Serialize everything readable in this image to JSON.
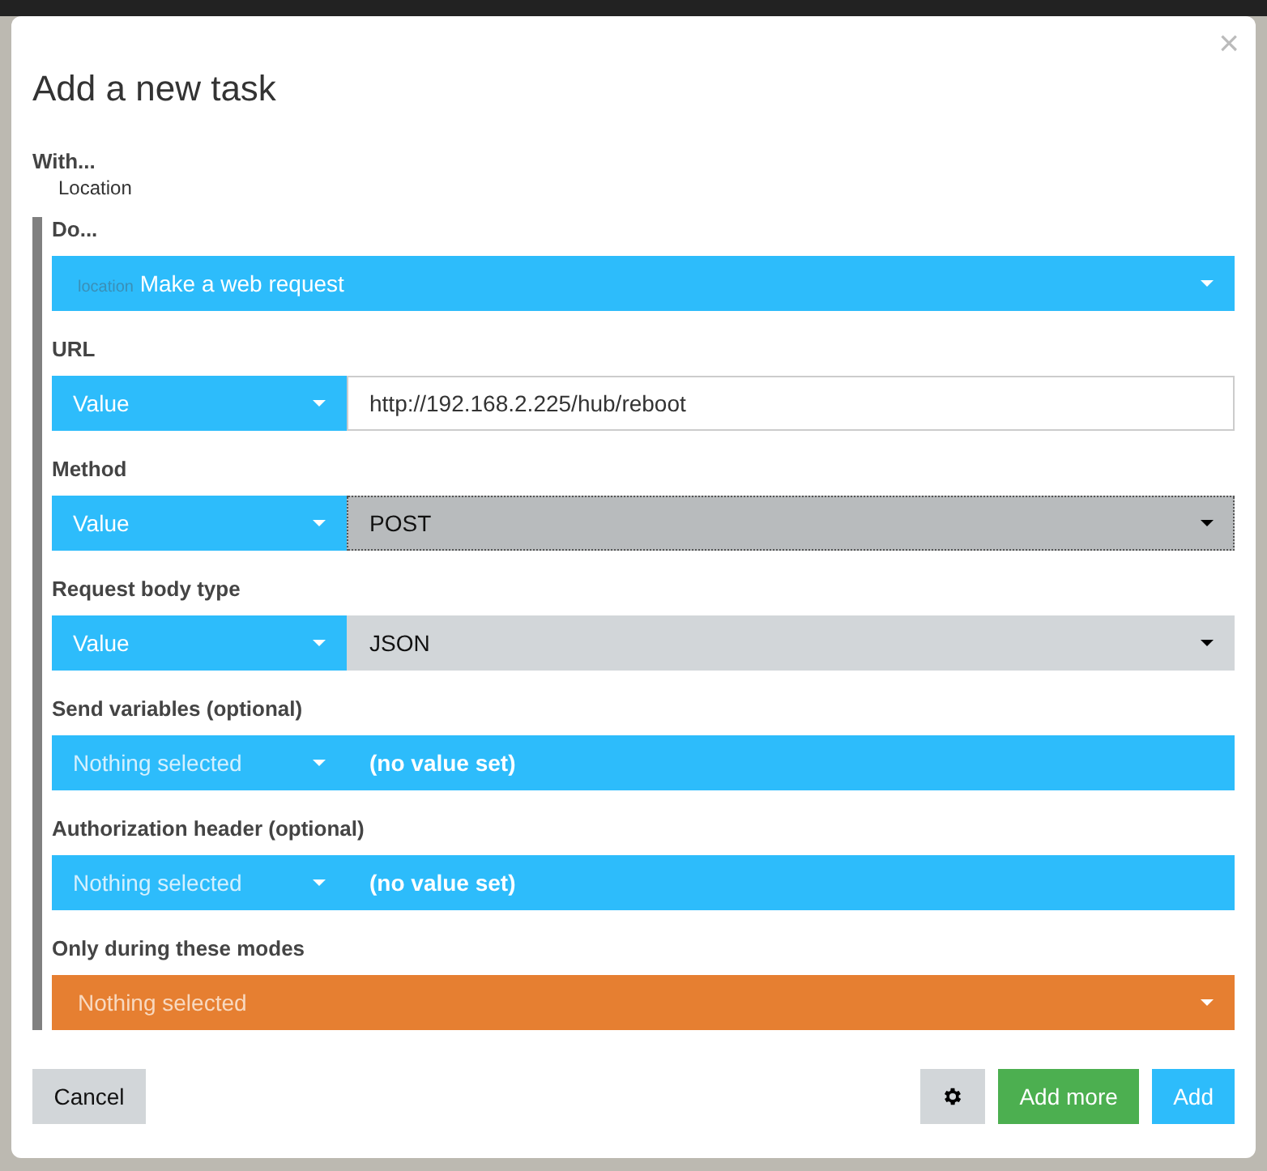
{
  "dialog": {
    "title": "Add a new task",
    "close": "×",
    "with": {
      "label": "With...",
      "value": "Location"
    },
    "do": {
      "label": "Do...",
      "prefix": "location",
      "value": "Make a web request"
    },
    "fields": [
      {
        "label": "URL",
        "kind": "input",
        "source": "Value",
        "value": "http://192.168.2.225/hub/reboot"
      },
      {
        "label": "Method",
        "kind": "select",
        "source": "Value",
        "value": "POST",
        "focused": true
      },
      {
        "label": "Request body type",
        "kind": "select",
        "source": "Value",
        "value": "JSON",
        "focused": false
      },
      {
        "label": "Send variables (optional)",
        "kind": "unset",
        "source": "Nothing selected",
        "value": "(no value set)"
      },
      {
        "label": "Authorization header (optional)",
        "kind": "unset",
        "source": "Nothing selected",
        "value": "(no value set)"
      },
      {
        "label": "Only during these modes",
        "kind": "modes",
        "value": "Nothing selected"
      }
    ],
    "cancel": "Cancel",
    "buttons": [
      {
        "kind": "settings"
      },
      {
        "kind": "secondary",
        "label": "Add more"
      },
      {
        "kind": "primary",
        "label": "Add"
      }
    ]
  }
}
